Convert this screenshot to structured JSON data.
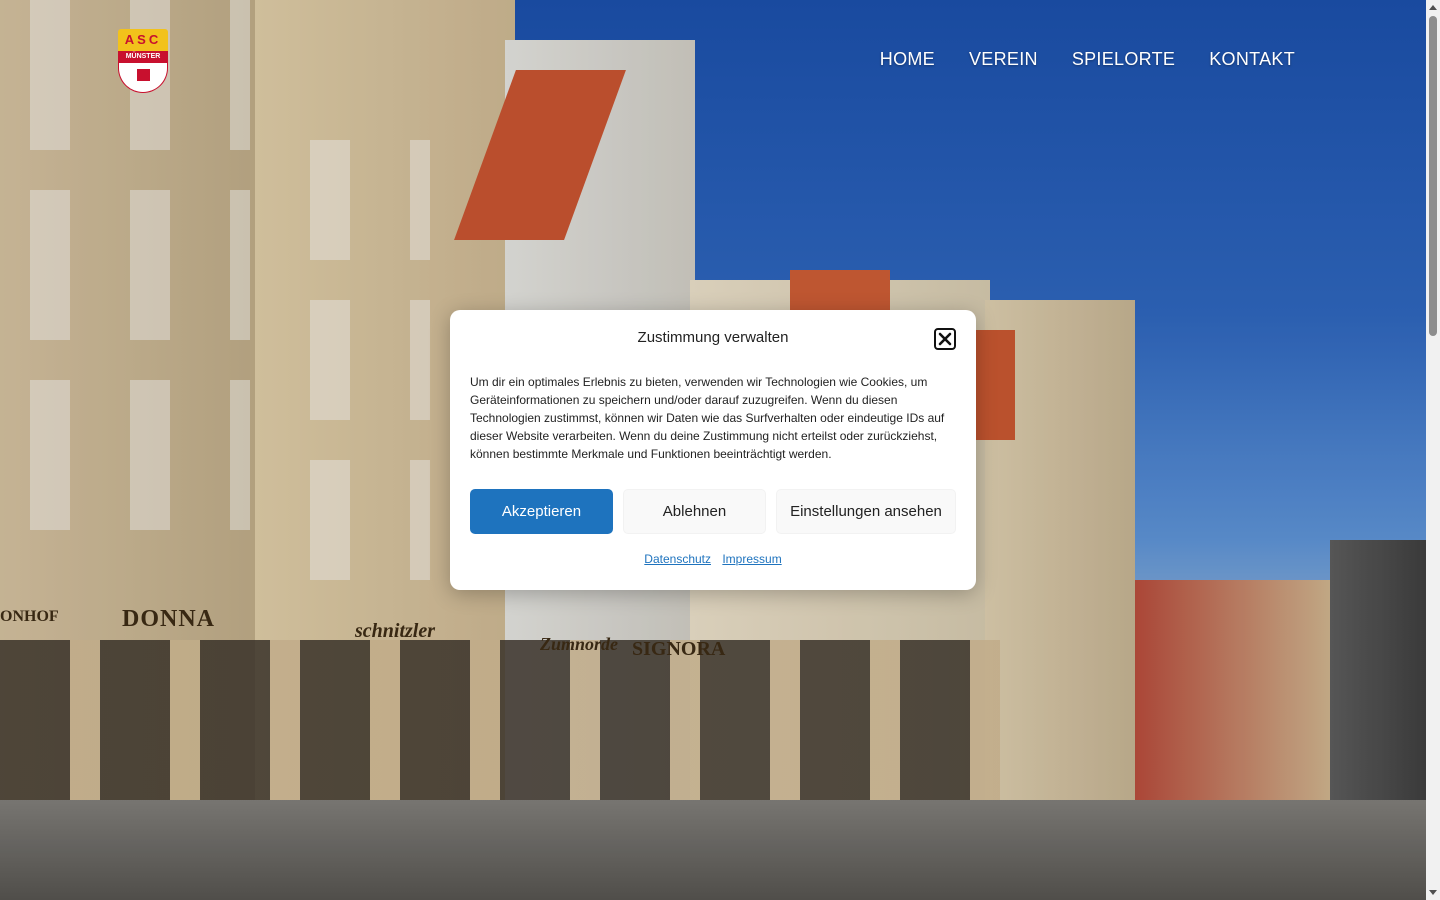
{
  "header": {
    "logo": {
      "top_text": "ASC",
      "sub_text": "MÜNSTER",
      "colors": {
        "yellow": "#f2c21b",
        "red": "#c8102e"
      }
    },
    "nav": [
      {
        "label": "HOME"
      },
      {
        "label": "VEREIN"
      },
      {
        "label": "SPIELORTE"
      },
      {
        "label": "KONTAKT"
      }
    ]
  },
  "background": {
    "signs": {
      "donna": "DONNA",
      "honhof": "ONHOF",
      "schnitzler": "schnitzler",
      "signora": "SIGNORA",
      "zumnorde": "Zumnorde"
    }
  },
  "consent": {
    "title": "Zustimmung verwalten",
    "text": "Um dir ein optimales Erlebnis zu bieten, verwenden wir Technologien wie Cookies, um Geräteinformationen zu speichern und/oder darauf zuzugreifen. Wenn du diesen Technologien zustimmst, können wir Daten wie das Surfverhalten oder eindeutige IDs auf dieser Website verarbeiten. Wenn du deine Zustimmung nicht erteilst oder zurückziehst, können bestimmte Merkmale und Funktionen beeinträchtigt werden.",
    "buttons": {
      "accept": "Akzeptieren",
      "deny": "Ablehnen",
      "settings": "Einstellungen ansehen"
    },
    "links": {
      "privacy": "Datenschutz",
      "imprint": "Impressum"
    },
    "accent_color": "#1e73be"
  }
}
